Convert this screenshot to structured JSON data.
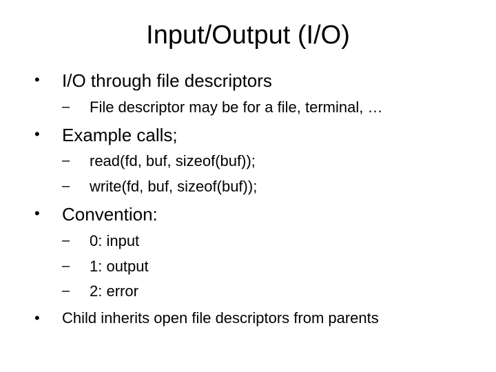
{
  "title": "Input/Output (I/O)",
  "items": [
    {
      "marker": "•",
      "text": "I/O through file descriptors",
      "sub": [
        {
          "marker": "–",
          "text": "File descriptor may be for a file, terminal, …"
        }
      ]
    },
    {
      "marker": "•",
      "text": "Example calls;",
      "sub": [
        {
          "marker": "–",
          "text": "read(fd, buf, sizeof(buf));"
        },
        {
          "marker": "–",
          "text": "write(fd, buf, sizeof(buf));"
        }
      ]
    },
    {
      "marker": "•",
      "text": "Convention:",
      "sub": [
        {
          "marker": "–",
          "text": "0: input"
        },
        {
          "marker": "–",
          "text": "1: output"
        },
        {
          "marker": "–",
          "text": "2: error"
        }
      ]
    },
    {
      "marker": "•",
      "text": "Child inherits open file descriptors from parents",
      "sub": []
    }
  ]
}
